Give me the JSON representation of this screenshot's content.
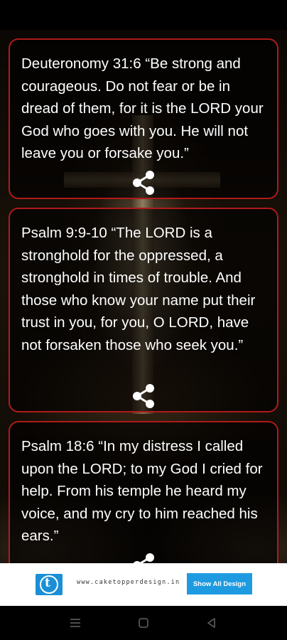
{
  "cards": [
    {
      "text": "Deuteronomy 31:6 “Be strong and courageous. Do not fear or be in dread of them, for it is the LORD your God who goes with you. He will not leave you or forsake you.”",
      "share_icon": "share-icon"
    },
    {
      "text": "Psalm 9:9-10 “The LORD is a stronghold for the oppressed, a stronghold in times of trouble. And those who know your name put their trust in you, for you, O LORD, have not forsaken those who seek you.”",
      "share_icon": "share-icon"
    },
    {
      "text": "Psalm 18:6 “In my distress I called upon the LORD; to my God I cried for help. From his temple he heard my voice, and my cry to him reached his ears.”",
      "share_icon": "share-icon"
    }
  ],
  "ad": {
    "logo_letter": "t",
    "url": "www.caketopperdesign.in",
    "button_label": "Show All Design"
  },
  "colors": {
    "card_border": "#b01a1a",
    "ad_accent": "#1e9be0"
  },
  "nav": {
    "icons": [
      "menu-icon",
      "home-icon",
      "back-icon"
    ]
  }
}
